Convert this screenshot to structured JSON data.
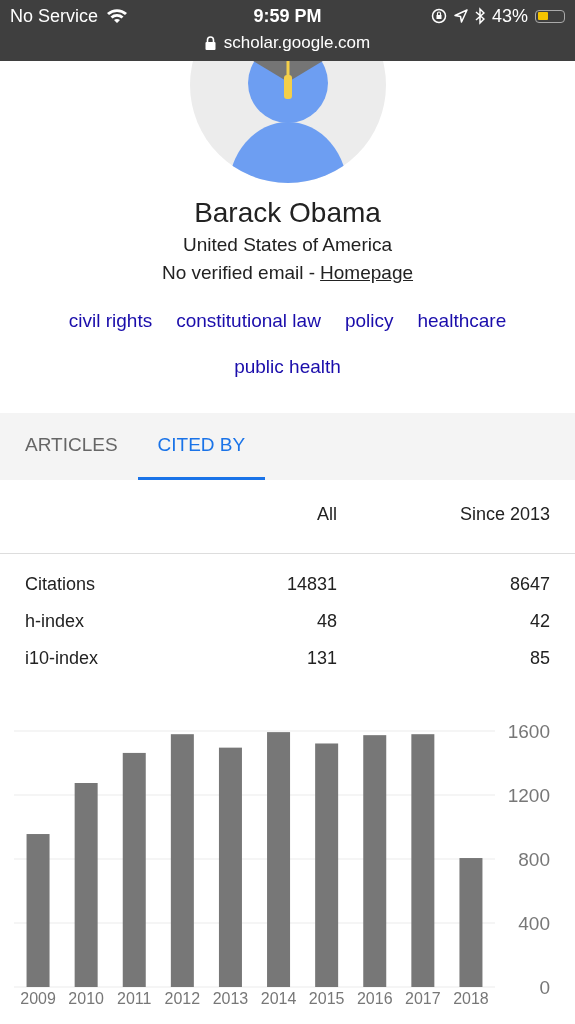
{
  "status_bar": {
    "carrier": "No Service",
    "time": "9:59 PM",
    "battery_percent": "43%",
    "url": "scholar.google.com"
  },
  "profile": {
    "name": "Barack Obama",
    "affiliation": "United States of America",
    "email_text": "No verified email -",
    "homepage_link": "Homepage"
  },
  "interests": [
    "civil rights",
    "constitutional law",
    "policy",
    "healthcare",
    "public health"
  ],
  "tabs": [
    {
      "label": "ARTICLES",
      "selected": false
    },
    {
      "label": "CITED BY",
      "selected": true
    }
  ],
  "citations_table": {
    "columns": [
      "",
      "All",
      "Since 2013"
    ],
    "rows": [
      [
        "Citations",
        "14831",
        "8647"
      ],
      [
        "h-index",
        "48",
        "42"
      ],
      [
        "i10-index",
        "131",
        "85"
      ]
    ]
  },
  "chart_data": {
    "type": "bar",
    "categories": [
      "2009",
      "2010",
      "2011",
      "2012",
      "2013",
      "2014",
      "2015",
      "2016",
      "2017",
      "2018"
    ],
    "values": [
      956,
      1275,
      1463,
      1580,
      1496,
      1593,
      1522,
      1574,
      1580,
      806
    ],
    "ylim": [
      0,
      1600
    ],
    "grid": true,
    "yticks": [
      0,
      400,
      800,
      1200,
      1600
    ]
  }
}
